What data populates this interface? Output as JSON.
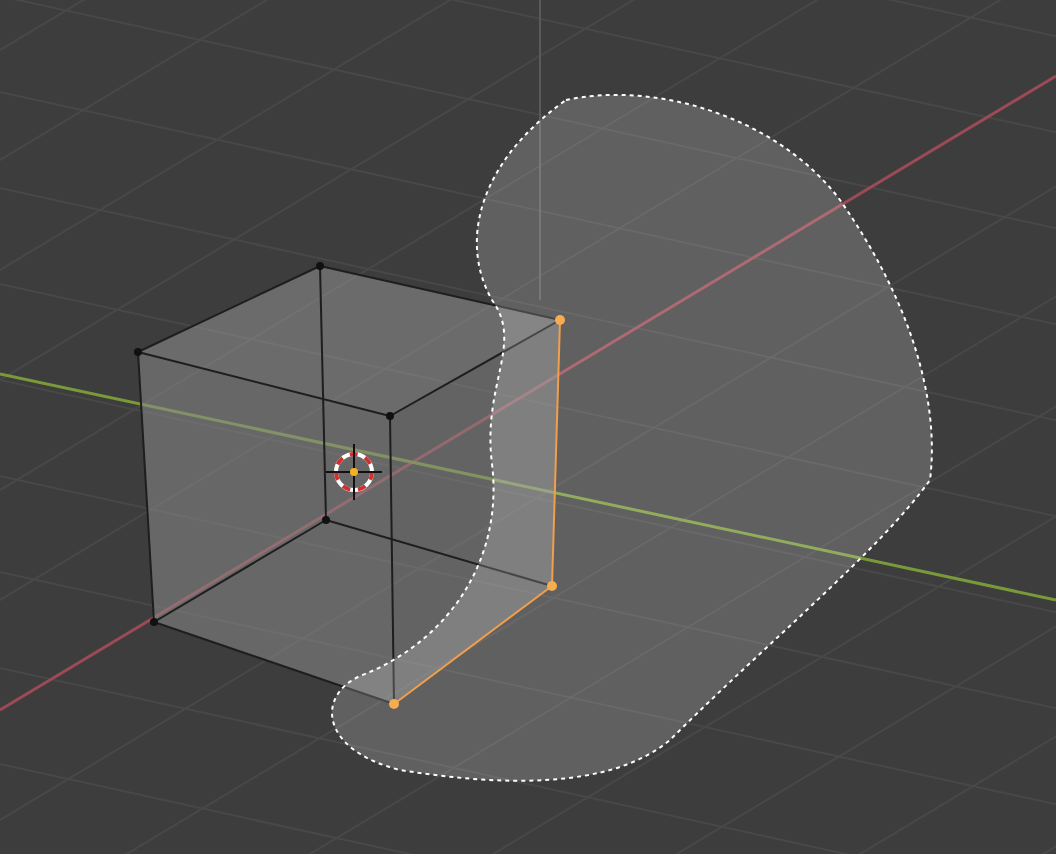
{
  "viewport": {
    "vertices": [
      {
        "selected": false
      },
      {
        "selected": false
      },
      {
        "selected": false
      },
      {
        "selected": true
      },
      {
        "selected": false
      },
      {
        "selected": true
      },
      {
        "selected": true
      },
      {
        "selected": false
      }
    ]
  }
}
